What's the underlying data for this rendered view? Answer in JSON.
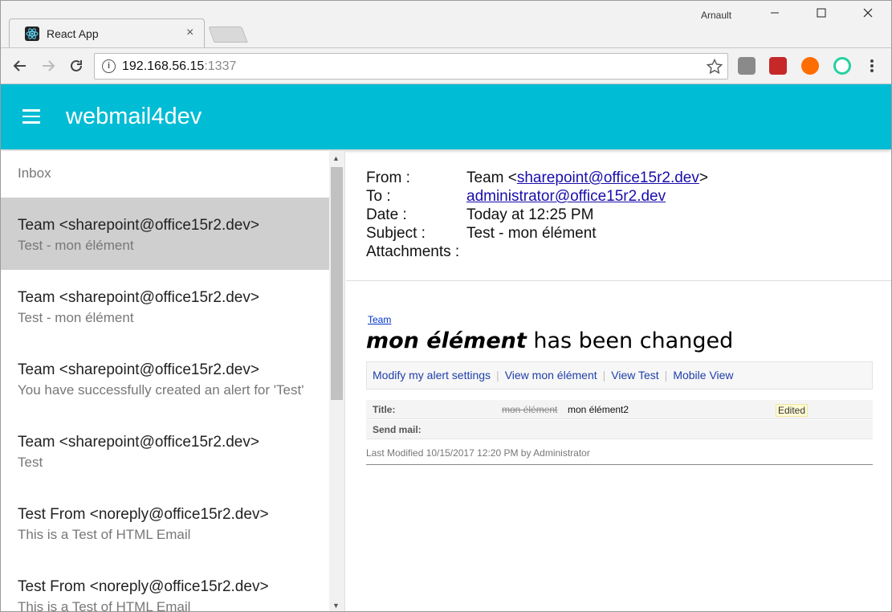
{
  "browser": {
    "tab_title": "React App",
    "tab_close": "×",
    "profile_name": "Arnault",
    "window_controls": {
      "minimize": "—",
      "maximize": "☐",
      "close": "✕"
    },
    "address": {
      "host": "192.168.56.15",
      "port": ":1337"
    },
    "icons": [
      "back-icon",
      "forward-icon",
      "reload-icon",
      "info-icon",
      "star-icon",
      "menu-dots-icon"
    ]
  },
  "app": {
    "title": "webmail4dev",
    "accent_color": "#00bcd4"
  },
  "sidebar": {
    "section_label": "Inbox",
    "items": [
      {
        "from": "Team <sharepoint@office15r2.dev>",
        "subject": "Test - mon élément",
        "selected": true
      },
      {
        "from": "Team <sharepoint@office15r2.dev>",
        "subject": "Test - mon élément",
        "selected": false
      },
      {
        "from": "Team <sharepoint@office15r2.dev>",
        "subject": "You have successfully created an alert for 'Test'",
        "selected": false
      },
      {
        "from": "Team <sharepoint@office15r2.dev>",
        "subject": "Test",
        "selected": false
      },
      {
        "from": "Test From <noreply@office15r2.dev>",
        "subject": "This is a Test of HTML Email",
        "selected": false
      },
      {
        "from": "Test From <noreply@office15r2.dev>",
        "subject": "This is a Test of HTML Email",
        "selected": false
      }
    ]
  },
  "message": {
    "labels": {
      "from": "From :",
      "to": "To :",
      "date": "Date :",
      "subject": "Subject :",
      "attachments": "Attachments :"
    },
    "from_name": "Team <",
    "from_email": "sharepoint@office15r2.dev",
    "from_suffix": ">",
    "to_email": "administrator@office15r2.dev",
    "date": "Today at 12:25 PM",
    "subject": "Test - mon élément",
    "body": {
      "site_link": "Team",
      "heading_item": "mon élément",
      "heading_rest": " has been changed",
      "links": [
        "Modify my alert settings",
        "View mon élément",
        "View Test",
        "Mobile View"
      ],
      "separator": "|",
      "rows": [
        {
          "label": "Title:",
          "old_value": "mon élément",
          "new_value": "mon élément2",
          "badge": "Edited"
        },
        {
          "label": "Send mail:"
        }
      ],
      "last_modified": "Last Modified 10/15/2017 12:20 PM by Administrator"
    }
  }
}
